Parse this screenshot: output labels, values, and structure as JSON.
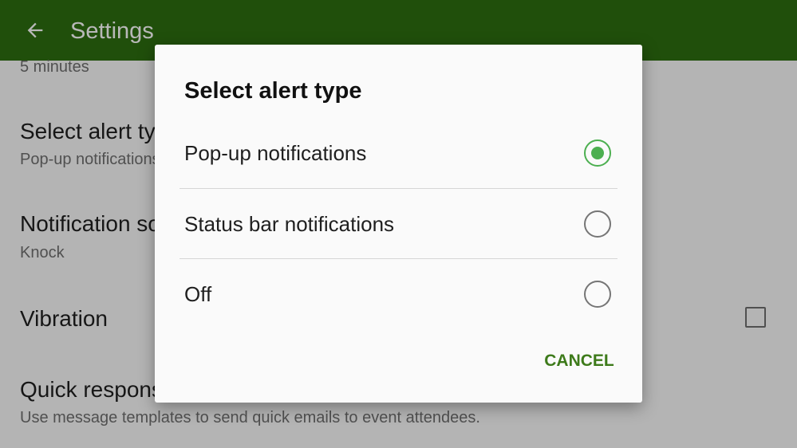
{
  "appbar": {
    "title": "Settings",
    "background": "#2d6e10"
  },
  "list": {
    "top_partial_sub": "5 minutes",
    "items": [
      {
        "title": "Select alert type",
        "sub": "Pop-up notifications"
      },
      {
        "title": "Notification sound",
        "sub": "Knock"
      },
      {
        "title": "Vibration",
        "checked": false
      },
      {
        "title": "Quick responses",
        "sub": "Use message templates to send quick emails to event attendees."
      }
    ]
  },
  "dialog": {
    "title": "Select alert type",
    "options": [
      {
        "label": "Pop-up notifications",
        "selected": true
      },
      {
        "label": "Status bar notifications",
        "selected": false
      },
      {
        "label": "Off",
        "selected": false
      }
    ],
    "cancel_label": "CANCEL",
    "accent_color": "#4caf50"
  },
  "icons": {
    "back": "arrow-left-icon"
  }
}
